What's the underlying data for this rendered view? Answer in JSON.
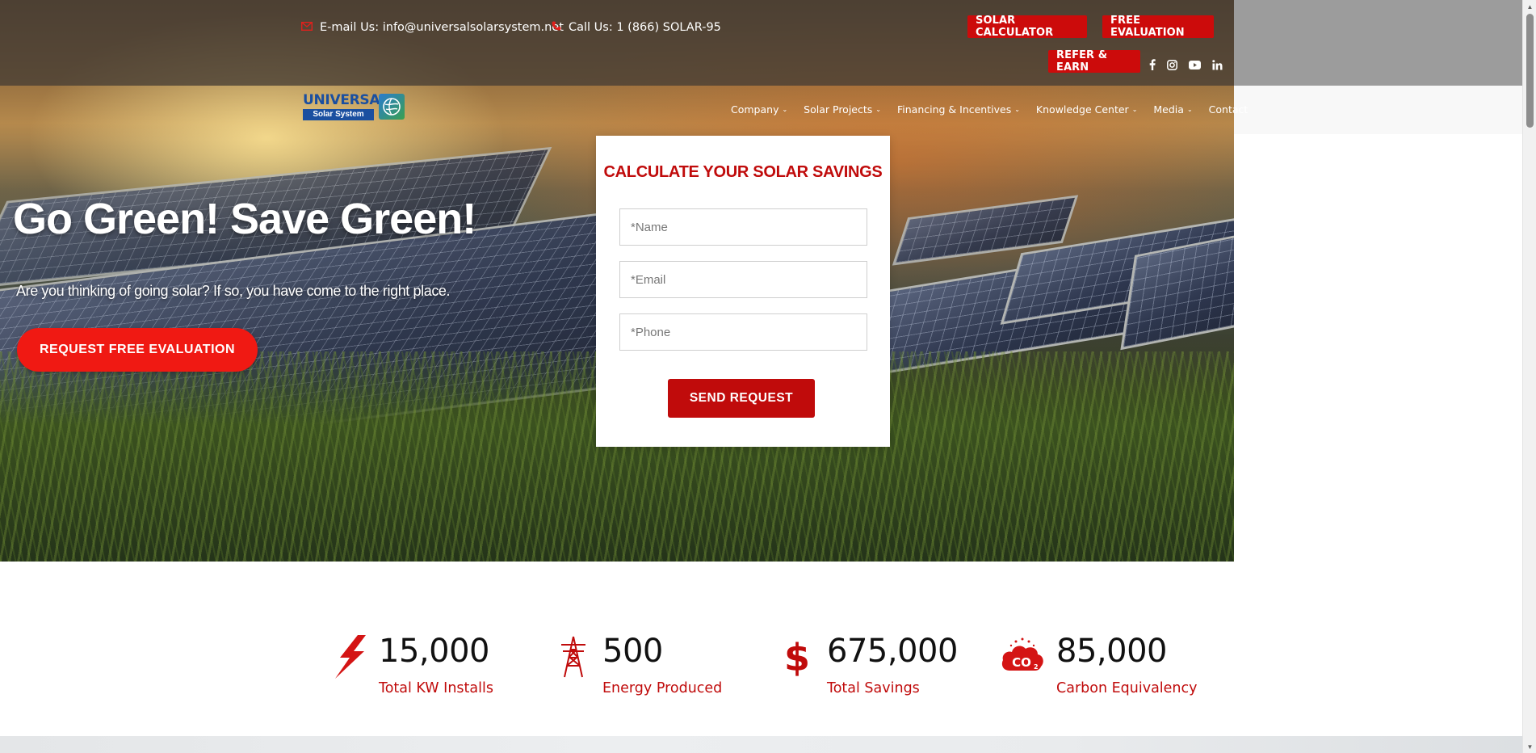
{
  "topbar": {
    "email_label": "E-mail Us: info@universalsolarsystem.net",
    "phone_label": "Call Us: 1 (866) SOLAR-95",
    "buttons": {
      "calculator": "SOLAR CALCULATOR",
      "evaluation": "FREE EVALUATION",
      "refer": "REFER & EARN"
    },
    "social": [
      "facebook-icon",
      "instagram-icon",
      "youtube-icon",
      "linkedin-icon"
    ]
  },
  "logo": {
    "word": "UNIVERSAL",
    "sub": "Solar System"
  },
  "nav": {
    "items": [
      {
        "label": "Company",
        "dropdown": true
      },
      {
        "label": "Solar Projects",
        "dropdown": true
      },
      {
        "label": "Financing & Incentives",
        "dropdown": true
      },
      {
        "label": "Knowledge Center",
        "dropdown": true
      },
      {
        "label": "Media",
        "dropdown": true
      },
      {
        "label": "Contact",
        "dropdown": false
      }
    ]
  },
  "hero": {
    "title": "Go Green! Save Green!",
    "subtitle": "Are you thinking of going solar? If so, you have come to the right place.",
    "cta": "REQUEST FREE EVALUATION"
  },
  "form": {
    "title": "CALCULATE YOUR SOLAR SAVINGS",
    "name_placeholder": "*Name",
    "email_placeholder": "*Email",
    "phone_placeholder": "*Phone",
    "submit": "SEND REQUEST"
  },
  "stats": [
    {
      "value": "15,000",
      "label": "Total KW Installs",
      "icon": "lightning-icon"
    },
    {
      "value": "500",
      "label": "Energy Produced",
      "icon": "power-tower-icon"
    },
    {
      "value": "675,000",
      "label": "Total Savings",
      "icon": "dollar-icon"
    },
    {
      "value": "85,000",
      "label": "Carbon Equivalency",
      "icon": "co2-cloud-icon"
    }
  ],
  "colors": {
    "accent": "#c00b0b",
    "cta": "#f01913",
    "logo_blue": "#1a4fa0"
  }
}
